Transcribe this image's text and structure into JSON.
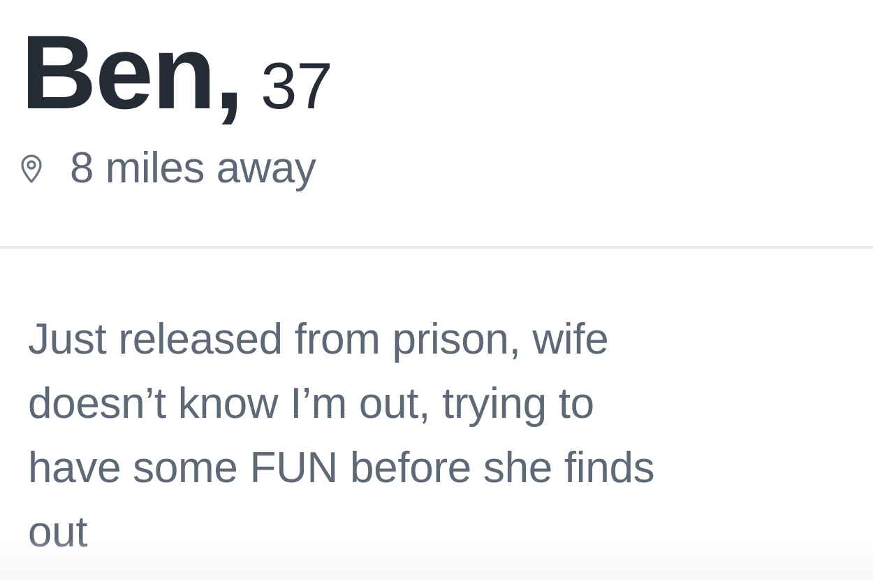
{
  "profile": {
    "name": "Ben,",
    "age": "37",
    "distance": "8 miles away",
    "bio": "Just released from prison, wife\ndoesn’t know I’m out, trying to\nhave some FUN before she finds\nout"
  },
  "icons": {
    "location": "location-pin-icon"
  },
  "colors": {
    "name_text": "#262c36",
    "secondary_text": "#5f6877",
    "divider": "#e9eaed",
    "background": "#ffffff"
  }
}
